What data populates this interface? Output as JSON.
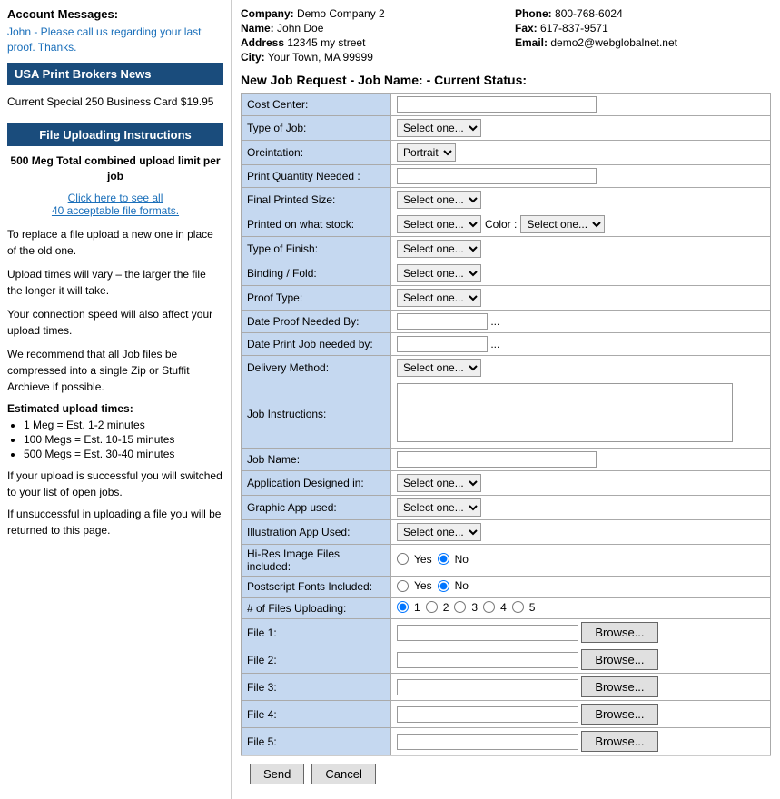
{
  "left": {
    "account_messages_title": "Account Messages:",
    "account_message": "John - Please call us regarding your last proof. Thanks.",
    "news_banner": "USA Print Brokers News",
    "news_special": "Current Special 250 Business Card $19.95",
    "upload_banner": "File Uploading Instructions",
    "upload_limit": "500 Meg Total combined upload limit per job",
    "click_here_line1": "Click here to see all",
    "click_here_line2": "40 acceptable file formats.",
    "info1": "To replace a file upload a new one in place of the old one.",
    "info2": "Upload times will vary – the larger the file the longer it will take.",
    "info3": "Your connection speed will also affect your upload times.",
    "info4": "We recommend that all Job files be compressed into a single Zip or Stuffit Archieve if possible.",
    "est_title": "Estimated upload times:",
    "est1": "1 Meg   = Est. 1-2 minutes",
    "est2": "100 Megs = Est. 10-15 minutes",
    "est3": "500 Megs = Est. 30-40 minutes",
    "footer1": "If your upload is successful you will switched to your list of open jobs.",
    "footer2": "If unsuccessful in uploading a file you will be returned to this page."
  },
  "right": {
    "company_label": "Company:",
    "company_value": "Demo Company 2",
    "name_label": "Name:",
    "name_value": "John Doe",
    "address_label": "Address",
    "address_value": "12345 my street",
    "city_label": "City:",
    "city_value": "Your Town, MA  99999",
    "phone_label": "Phone:",
    "phone_value": "800-768-6024",
    "fax_label": "Fax:",
    "fax_value": "617-837-9571",
    "email_label": "Email:",
    "email_value": "demo2@webglobalnet.net",
    "job_title": "New Job Request - Job Name:  - Current Status:",
    "fields": {
      "cost_center": "Cost Center:",
      "type_of_job": "Type of Job:",
      "orientation": "Oreintation:",
      "print_quantity": "Print Quantity Needed :",
      "final_printed_size": "Final Printed Size:",
      "printed_on_stock": "Printed on what stock:",
      "color_label": "Color :",
      "type_of_finish": "Type of Finish:",
      "binding_fold": "Binding / Fold:",
      "proof_type": "Proof Type:",
      "date_proof": "Date Proof Needed By:",
      "date_print": "Date Print Job needed by:",
      "delivery_method": "Delivery Method:",
      "job_instructions": "Job Instructions:",
      "job_name": "Job Name:",
      "app_designed": "Application Designed in:",
      "graphic_app": "Graphic App used:",
      "illustration_app": "Illustration App Used:",
      "hi_res": "Hi-Res Image Files included:",
      "postscript": "Postscript Fonts Included:",
      "num_files": "# of Files Uploading:",
      "file1": "File 1:",
      "file2": "File 2:",
      "file3": "File 3:",
      "file4": "File 4:",
      "file5": "File 5:"
    },
    "selects": {
      "select_one": "Select one...",
      "portrait": "Portrait"
    },
    "buttons": {
      "send": "Send",
      "cancel": "Cancel",
      "browse": "Browse..."
    }
  }
}
